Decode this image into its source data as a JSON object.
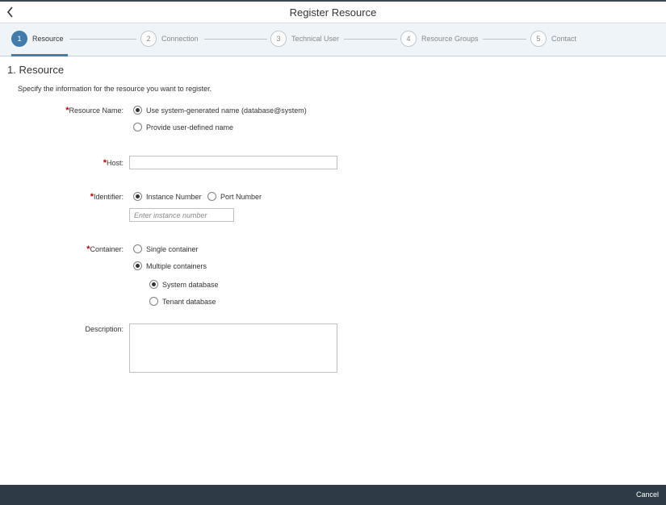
{
  "header": {
    "title": "Register Resource",
    "back_icon": "chevron-left-icon"
  },
  "wizard": {
    "steps": [
      {
        "number": "1",
        "label": "Resource"
      },
      {
        "number": "2",
        "label": "Connection"
      },
      {
        "number": "3",
        "label": "Technical User"
      },
      {
        "number": "4",
        "label": "Resource Groups"
      },
      {
        "number": "5",
        "label": "Contact"
      }
    ],
    "active_step": 1,
    "accent_color": "#427cac"
  },
  "form": {
    "section_title": "1. Resource",
    "intro": "Specify the information for the resource you want to register.",
    "required_marker": "*",
    "resource_name": {
      "label": "Resource Name:",
      "options": [
        "Use system-generated name (database@system)",
        "Provide user-defined name"
      ],
      "selected": 0
    },
    "host": {
      "label": "Host:",
      "value": "",
      "placeholder": ""
    },
    "identifier": {
      "label": "Identifier:",
      "options": [
        "Instance Number",
        "Port Number"
      ],
      "selected": 0,
      "input_value": "",
      "input_placeholder": "Enter instance number"
    },
    "container": {
      "label": "Container:",
      "options": [
        "Single container",
        "Multiple containers"
      ],
      "selected": 1,
      "sub_options": [
        "System database",
        "Tenant database"
      ],
      "sub_selected": 0
    },
    "description": {
      "label": "Description:",
      "value": ""
    }
  },
  "footer": {
    "cancel_label": "Cancel"
  }
}
